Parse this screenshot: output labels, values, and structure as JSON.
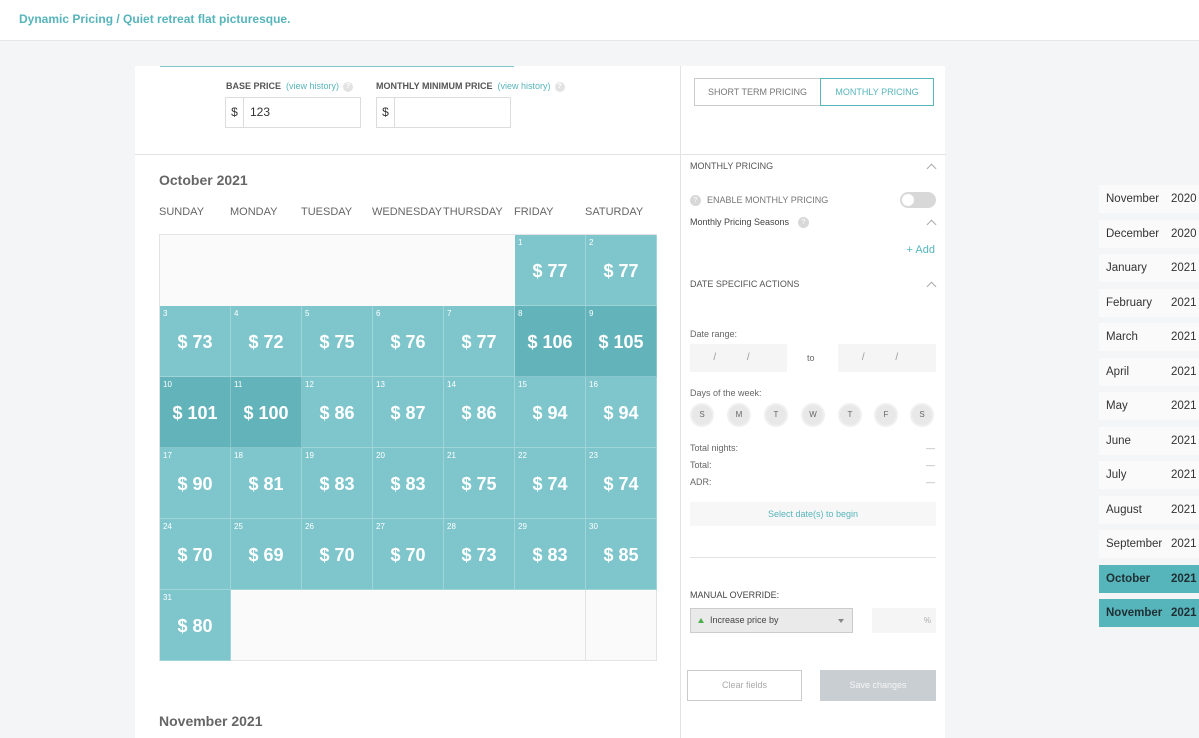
{
  "breadcrumb": "Dynamic Pricing / Quiet retreat flat picturesque.",
  "pricing": {
    "base_label": "BASE PRICE",
    "monthly_min_label": "MONTHLY MINIMUM PRICE",
    "view_history": "(view history)",
    "help": "?",
    "currency": "$",
    "base_value": "123",
    "monthly_min_value": ""
  },
  "calendar": {
    "month_title": "October 2021",
    "next_month_title": "November 2021",
    "days_of_week": [
      "SUNDAY",
      "MONDAY",
      "TUESDAY",
      "WEDNESDAY",
      "THURSDAY",
      "FRIDAY",
      "SATURDAY"
    ],
    "first_weekday": 5,
    "days": [
      {
        "d": "1",
        "p": "$ 77"
      },
      {
        "d": "2",
        "p": "$ 77"
      },
      {
        "d": "3",
        "p": "$ 73"
      },
      {
        "d": "4",
        "p": "$ 72"
      },
      {
        "d": "5",
        "p": "$ 75"
      },
      {
        "d": "6",
        "p": "$ 76"
      },
      {
        "d": "7",
        "p": "$ 77"
      },
      {
        "d": "8",
        "p": "$ 106",
        "dark": true
      },
      {
        "d": "9",
        "p": "$ 105",
        "dark": true
      },
      {
        "d": "10",
        "p": "$ 101",
        "dark": true
      },
      {
        "d": "11",
        "p": "$ 100",
        "dark": true
      },
      {
        "d": "12",
        "p": "$ 86"
      },
      {
        "d": "13",
        "p": "$ 87"
      },
      {
        "d": "14",
        "p": "$ 86"
      },
      {
        "d": "15",
        "p": "$ 94"
      },
      {
        "d": "16",
        "p": "$ 94"
      },
      {
        "d": "17",
        "p": "$ 90"
      },
      {
        "d": "18",
        "p": "$ 81"
      },
      {
        "d": "19",
        "p": "$ 83"
      },
      {
        "d": "20",
        "p": "$ 83"
      },
      {
        "d": "21",
        "p": "$ 75"
      },
      {
        "d": "22",
        "p": "$ 74"
      },
      {
        "d": "23",
        "p": "$ 74"
      },
      {
        "d": "24",
        "p": "$ 70"
      },
      {
        "d": "25",
        "p": "$ 69"
      },
      {
        "d": "26",
        "p": "$ 70"
      },
      {
        "d": "27",
        "p": "$ 70"
      },
      {
        "d": "28",
        "p": "$ 73"
      },
      {
        "d": "29",
        "p": "$ 83"
      },
      {
        "d": "30",
        "p": "$ 85"
      },
      {
        "d": "31",
        "p": "$ 80"
      }
    ]
  },
  "sidebar": {
    "short_term_tab": "SHORT TERM PRICING",
    "monthly_tab": "MONTHLY PRICING",
    "monthly_section": "MONTHLY PRICING",
    "enable_monthly": "ENABLE MONTHLY PRICING",
    "seasons": "Monthly Pricing Seasons",
    "add": "+ Add",
    "date_actions": "DATE SPECIFIC ACTIONS",
    "date_range": "Date range:",
    "date_placeholder": "/ /",
    "to": "to",
    "days_label": "Days of the week:",
    "day_letters": [
      "S",
      "M",
      "T",
      "W",
      "T",
      "F",
      "S"
    ],
    "total_nights": "Total nights:",
    "total": "Total:",
    "adr": "ADR:",
    "dash": "—",
    "select_begin": "Select date(s) to begin",
    "manual_override": "MANUAL OVERRIDE:",
    "increase_option": "Increase price by",
    "pct": "%",
    "clear": "Clear fields",
    "save": "Save changes"
  },
  "months": [
    {
      "m": "November",
      "y": "2020"
    },
    {
      "m": "December",
      "y": "2020"
    },
    {
      "m": "January",
      "y": "2021"
    },
    {
      "m": "February",
      "y": "2021"
    },
    {
      "m": "March",
      "y": "2021"
    },
    {
      "m": "April",
      "y": "2021"
    },
    {
      "m": "May",
      "y": "2021"
    },
    {
      "m": "June",
      "y": "2021"
    },
    {
      "m": "July",
      "y": "2021"
    },
    {
      "m": "August",
      "y": "2021"
    },
    {
      "m": "September",
      "y": "2021"
    },
    {
      "m": "October",
      "y": "2021",
      "active": true
    },
    {
      "m": "November",
      "y": "2021",
      "active": true
    }
  ],
  "colors": {
    "accent": "#56b4bb",
    "cell": "#7fc6cc",
    "cell_dark": "#62b3ba"
  }
}
